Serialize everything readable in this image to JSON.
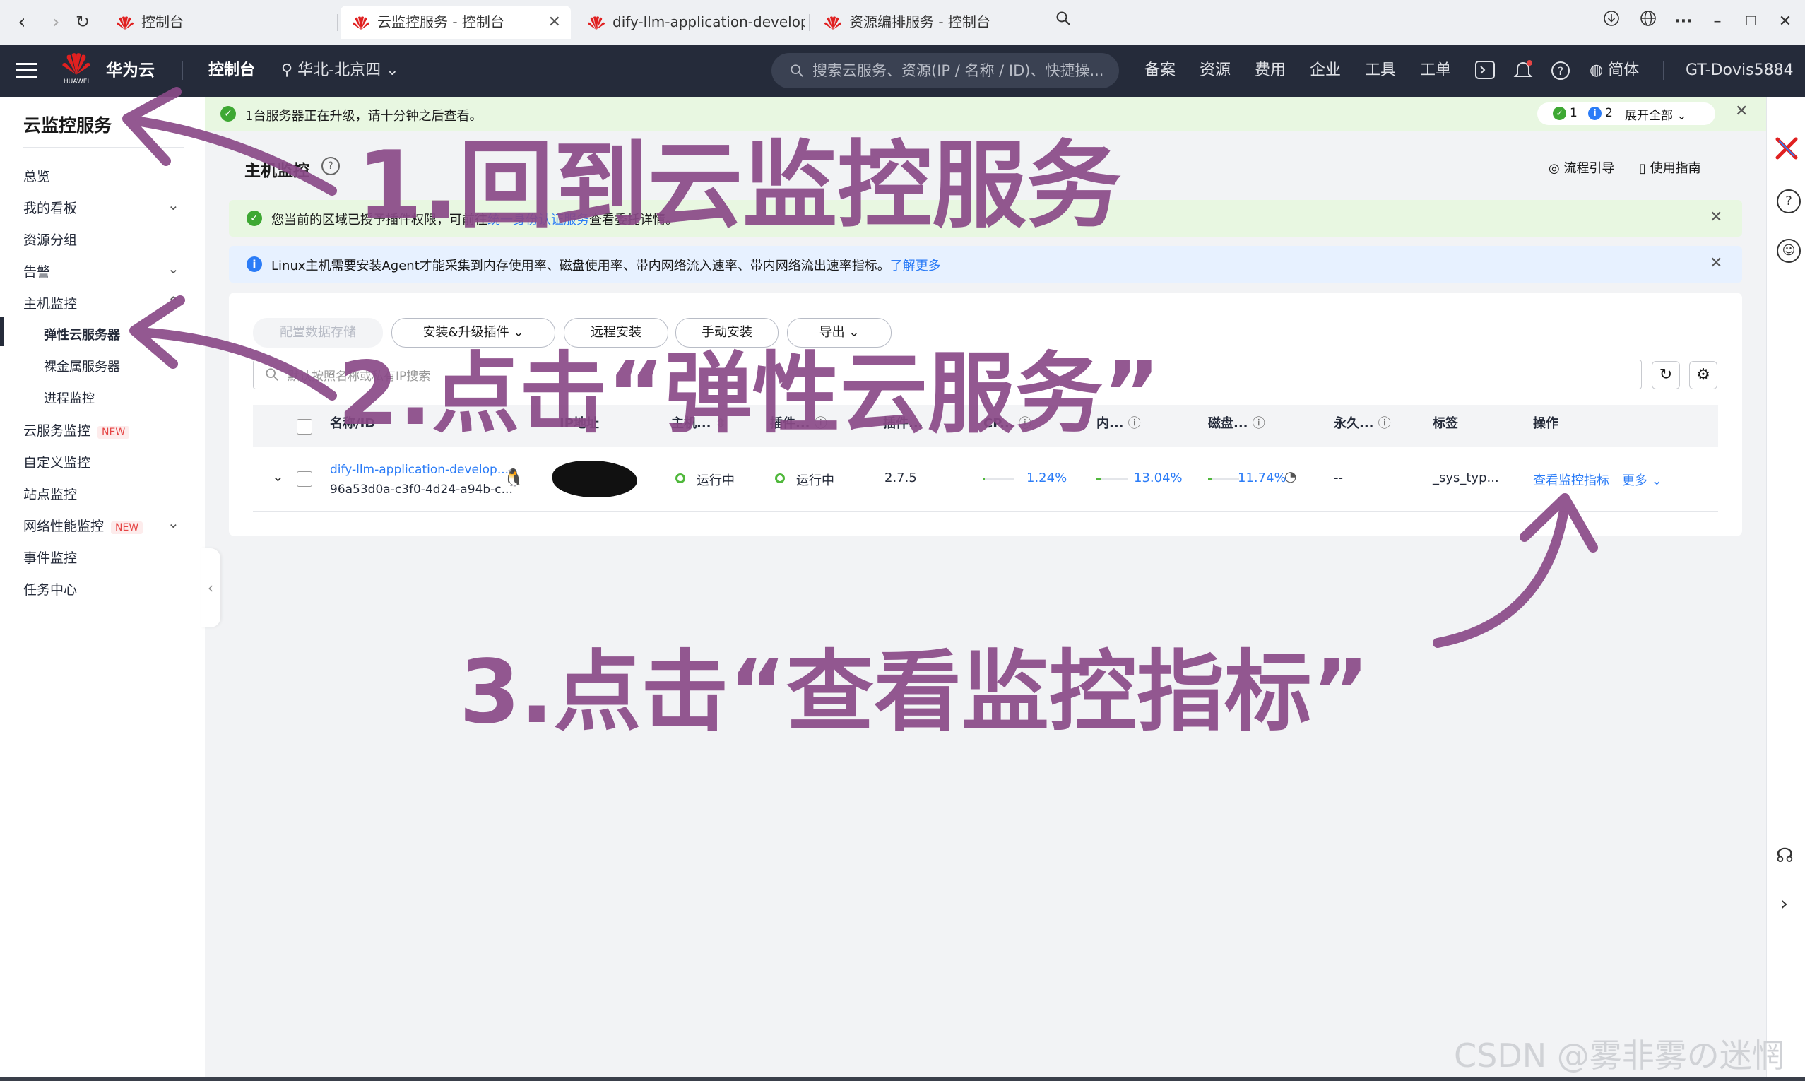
{
  "browser": {
    "tabs": [
      {
        "label": "控制台",
        "active": false
      },
      {
        "label": "云监控服务 - 控制台",
        "active": true
      },
      {
        "label": "dify-llm-application-developme",
        "active": false
      },
      {
        "label": "资源编排服务 - 控制台",
        "active": false
      }
    ],
    "more": "···"
  },
  "topnav": {
    "brand": "华为云",
    "brand_small": "HUAWEI",
    "console": "控制台",
    "region": "华北-北京四",
    "search_placeholder": "搜索云服务、资源(IP / 名称 / ID)、快捷操...",
    "links": [
      "备案",
      "资源",
      "费用",
      "企业",
      "工具",
      "工单"
    ],
    "lang": "简体",
    "user": "GT-Dovis5884"
  },
  "sidebar": {
    "title": "云监控服务",
    "items": [
      {
        "label": "总览"
      },
      {
        "label": "我的看板",
        "expand": true
      },
      {
        "label": "资源分组"
      },
      {
        "label": "告警",
        "expand": true
      },
      {
        "label": "主机监控",
        "expanded": true
      },
      {
        "label": "弹性云服务器",
        "sub": true,
        "selected": true
      },
      {
        "label": "裸金属服务器",
        "sub": true
      },
      {
        "label": "进程监控",
        "sub": true
      },
      {
        "label": "云服务监控",
        "tag": "NEW"
      },
      {
        "label": "自定义监控"
      },
      {
        "label": "站点监控"
      },
      {
        "label": "网络性能监控",
        "tag": "NEW",
        "expand": true
      },
      {
        "label": "事件监控"
      },
      {
        "label": "任务中心"
      }
    ]
  },
  "upgrade_banner": {
    "text": "1台服务器正在升级，请十分钟之后查看。",
    "count_green": "1",
    "count_blue": "2",
    "expand_all": "展开全部"
  },
  "page": {
    "title": "主机监控",
    "flow_guide": "流程引导",
    "user_guide": "使用指南"
  },
  "notice_green": {
    "text_a": "您当前的区域已",
    "text_b": "授予插件权限",
    "text_c": "，可前往",
    "link": "统一身份认证服务",
    "text_d": "查看委托详情。"
  },
  "notice_blue": {
    "text": "Linux主机需要安装Agent才能采集到内存使用率、磁盘使用率、带内网络流入速率、带内网络流出速率指标。",
    "link": "了解更多"
  },
  "toolbar": {
    "config_storage": "配置数据存储",
    "install_plugin": "安装&升级插件",
    "remote_install": "远程安装",
    "manual_install": "手动安装",
    "export": "导出",
    "search_placeholder": "默认按照名称或私有IP搜索"
  },
  "table": {
    "headers": [
      "名称/ID",
      "IP地址",
      "主机...",
      "插件...",
      "插件...",
      "CP...",
      "内...",
      "磁盘...",
      "永久...",
      "标签",
      "操作"
    ],
    "rows": [
      {
        "name": "dify-llm-application-develop...",
        "id": "96a53d0a-c3f0-4d24-a94b-c...",
        "host_status": "运行中",
        "plugin_status": "运行中",
        "plugin_version": "2.7.5",
        "cpu": "1.24%",
        "cpu_frac": 0.0124,
        "mem": "13.04%",
        "mem_frac": 0.1304,
        "disk": "11.74%",
        "disk_frac": 0.1174,
        "permanent": "--",
        "tag": "_sys_typ...",
        "action_view": "查看监控指标",
        "action_more": "更多"
      }
    ]
  },
  "annotations": {
    "step1": "1.回到云监控服务",
    "step2": "2.点击“弹性云服务”",
    "step3": "3.点击“查看监控指标”",
    "color": "#8a4a88"
  },
  "watermark": "CSDN @雾非雾の迷惘"
}
